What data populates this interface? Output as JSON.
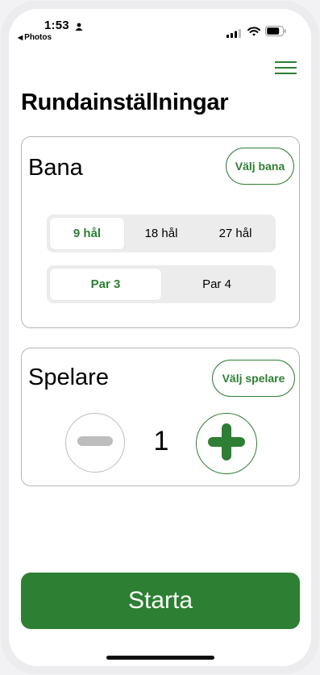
{
  "status_bar": {
    "time": "1:53",
    "back_label": "Photos",
    "back_arrow": "◀"
  },
  "header": {
    "title": "Rundainställningar"
  },
  "course_card": {
    "title": "Bana",
    "choose_button": "Välj bana",
    "holes_options": [
      "9 hål",
      "18 hål",
      "27 hål"
    ],
    "holes_selected": "9 hål",
    "par_options": [
      "Par 3",
      "Par 4"
    ],
    "par_selected": "Par 3"
  },
  "players_card": {
    "title": "Spelare",
    "choose_button": "Välj spelare",
    "count": "1"
  },
  "start_button": "Starta",
  "colors": {
    "accent": "#2d7f33",
    "disabled": "#bdbdbd",
    "segment_bg": "#ececec"
  },
  "icons": {
    "menu": "hamburger-menu-icon",
    "minus": "minus-icon",
    "plus": "plus-icon"
  }
}
